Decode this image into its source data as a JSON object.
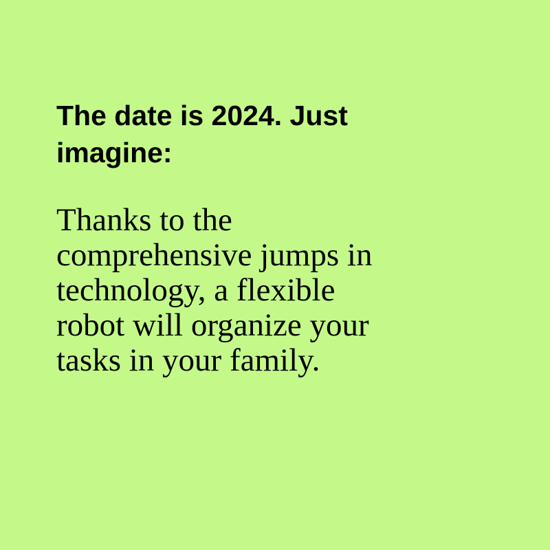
{
  "colors": {
    "background": "#c4f98a",
    "text": "#000000"
  },
  "heading": {
    "lines": [
      "The date is 2024. Just",
      "imagine:"
    ]
  },
  "body": {
    "lines": [
      "Thanks to the",
      "comprehensive jumps in",
      "technology, a flexible",
      "robot will organize your",
      "tasks in your family."
    ]
  }
}
